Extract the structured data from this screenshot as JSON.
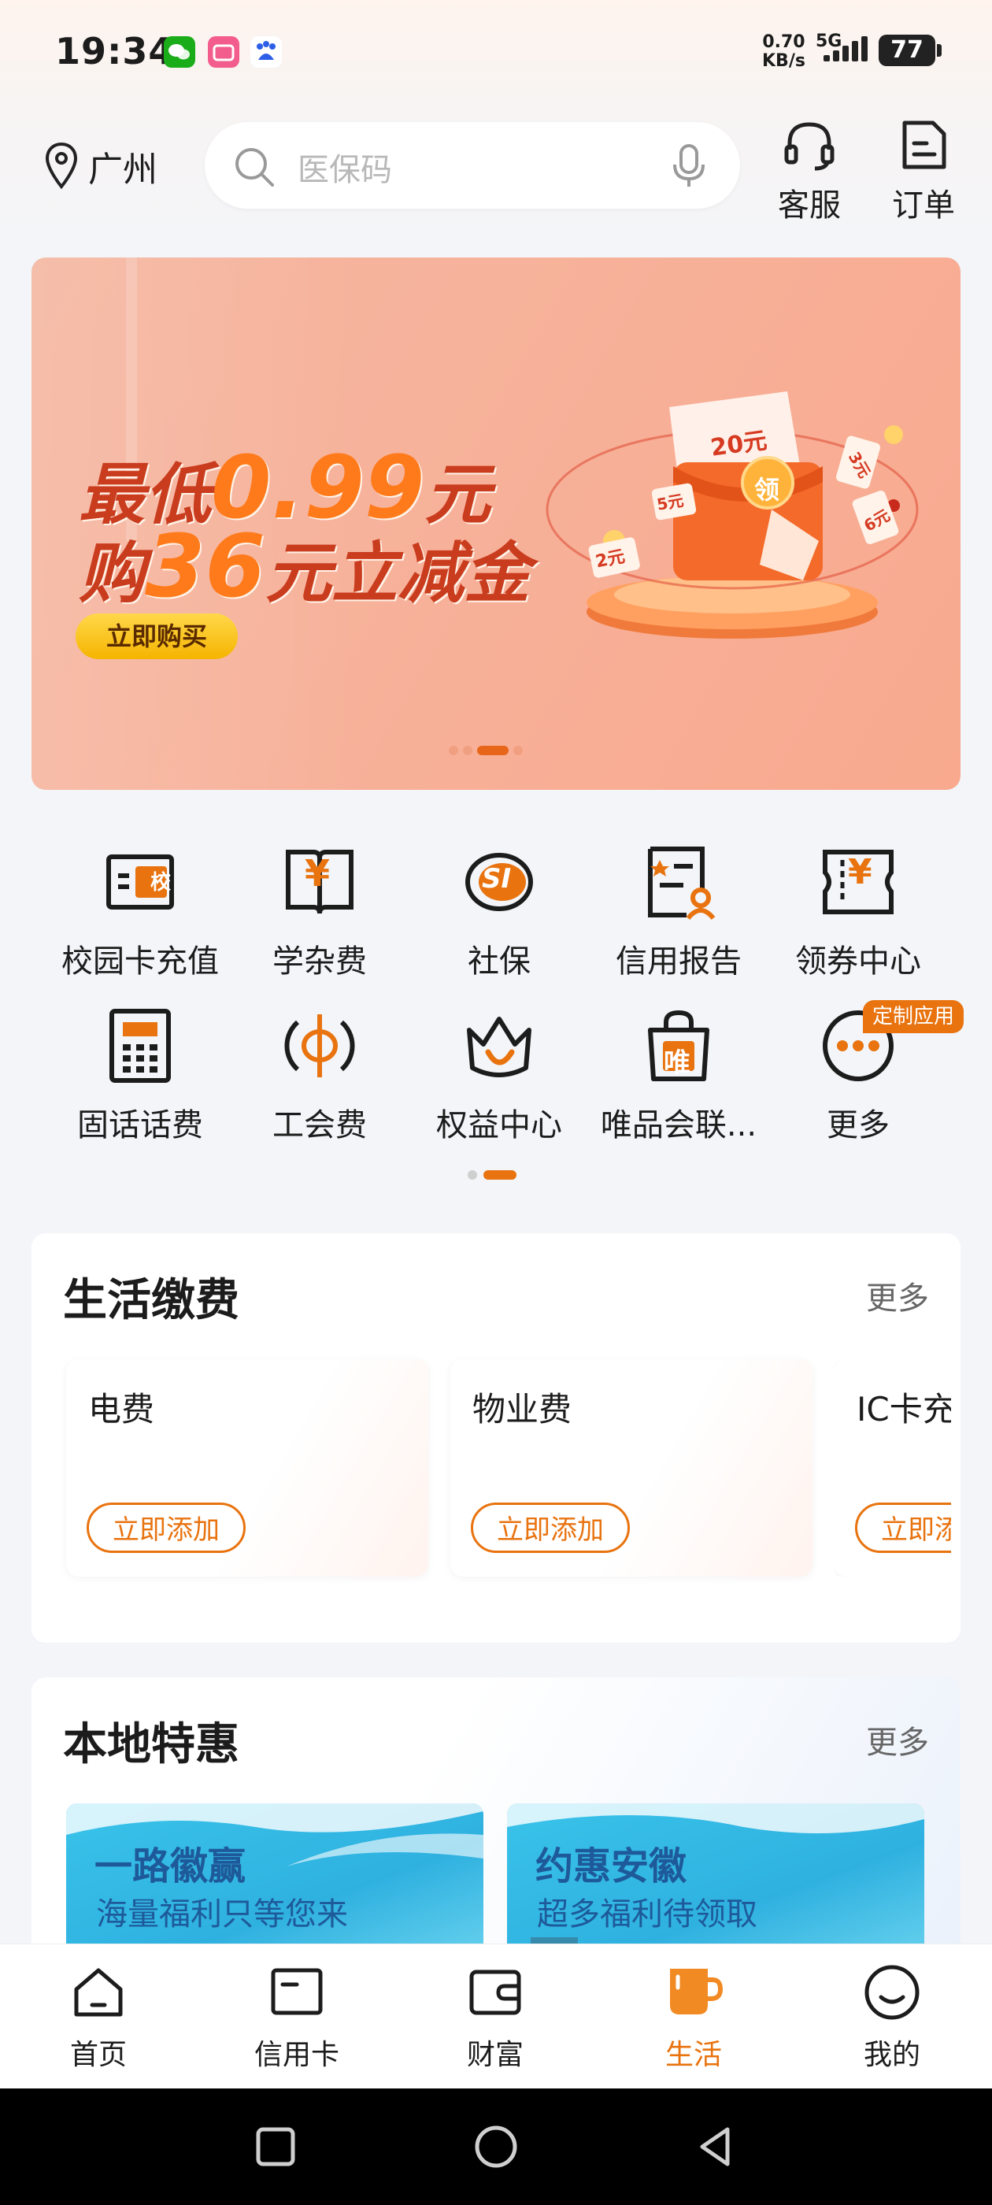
{
  "status_bar": {
    "time": "19:34",
    "net_speed_value": "0.70",
    "net_speed_unit": "KB/s",
    "network": "5G",
    "battery": "77"
  },
  "header": {
    "location": "广州",
    "search_placeholder": "医保码",
    "service_label": "客服",
    "orders_label": "订单"
  },
  "banner": {
    "line1_prefix": "最低",
    "line1_value": "0.99",
    "line1_suffix": "元",
    "line2_prefix": "购",
    "line2_value": "36",
    "line2_suffix": "元立减金",
    "button": "立即购买",
    "badge_value": "20元",
    "badge_center": "领",
    "chip_5": "5元",
    "chip_2": "2元",
    "chip_3": "3元",
    "chip_6": "6元"
  },
  "quick_grid": {
    "row1": [
      {
        "label": "校园卡充值",
        "icon": "campus-card-icon"
      },
      {
        "label": "学杂费",
        "icon": "tuition-book-icon"
      },
      {
        "label": "社保",
        "icon": "social-security-icon"
      },
      {
        "label": "信用报告",
        "icon": "credit-report-icon"
      },
      {
        "label": "领券中心",
        "icon": "coupon-icon"
      }
    ],
    "row2": [
      {
        "label": "固话话费",
        "icon": "landline-phone-icon"
      },
      {
        "label": "工会费",
        "icon": "union-fee-icon"
      },
      {
        "label": "权益中心",
        "icon": "crown-icon"
      },
      {
        "label": "唯品会联...",
        "icon": "shopping-bag-icon"
      },
      {
        "label": "更多",
        "icon": "more-dots-icon"
      }
    ],
    "tag": "定制应用",
    "grid_icon_small_text": "校",
    "yen_symbol": "¥",
    "si_text": "SI",
    "vip_text": "唯"
  },
  "life_payments": {
    "title": "生活缴费",
    "more": "更多",
    "items": [
      {
        "name": "电费",
        "button": "立即添加"
      },
      {
        "name": "物业费",
        "button": "立即添加"
      },
      {
        "name": "IC卡充",
        "button": "立即添加"
      }
    ]
  },
  "local_deals": {
    "title": "本地特惠",
    "more": "更多",
    "promos": [
      {
        "title": "一路徽赢",
        "subtitle": "海量福利只等您来"
      },
      {
        "title": "约惠安徽",
        "subtitle": "超多福利待领取"
      }
    ]
  },
  "bottom_nav": [
    {
      "label": "首页",
      "icon": "home-icon"
    },
    {
      "label": "信用卡",
      "icon": "credit-card-icon"
    },
    {
      "label": "财富",
      "icon": "wallet-icon"
    },
    {
      "label": "生活",
      "icon": "cup-icon",
      "active": true
    },
    {
      "label": "我的",
      "icon": "smile-icon"
    }
  ],
  "colors": {
    "accent": "#e8730f",
    "banner_bg": "#f6b29a",
    "banner_text": "#c93c1e"
  }
}
